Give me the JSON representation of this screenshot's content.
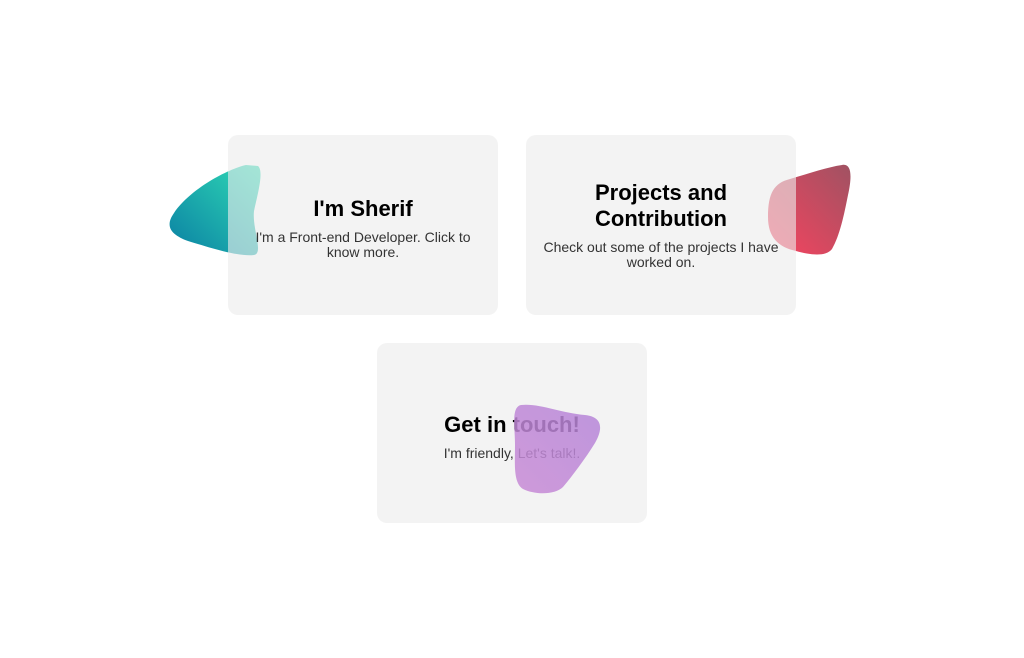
{
  "cards": [
    {
      "title": "I'm Sherif",
      "description": "I'm a Front-end Developer. Click to know more.",
      "blob_colors": [
        "#0e8aa7",
        "#2dd4b4"
      ]
    },
    {
      "title": "Projects and Contribution",
      "description": "Check out some of the projects I have worked on.",
      "blob_colors": [
        "#f24a64",
        "#a85764"
      ]
    },
    {
      "title": "Get in touch!",
      "description": "I'm friendly, Let's talk!.",
      "blob_colors": [
        "#c98cd7",
        "#b58ad8"
      ]
    }
  ],
  "colors": {
    "card_background": "#f2f2f2",
    "page_background": "#ffffff"
  }
}
